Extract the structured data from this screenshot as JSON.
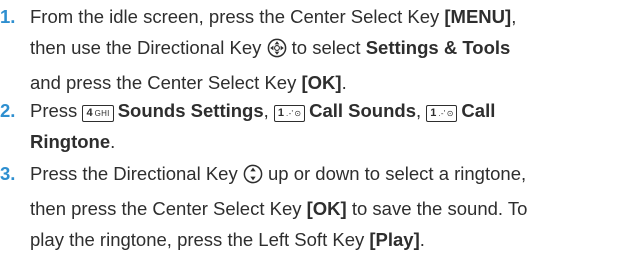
{
  "steps": [
    {
      "number": "1.",
      "line1": {
        "t1": "From the idle screen, press the Center Select Key ",
        "menu_key": "[MENU]",
        "t2": ","
      },
      "line2": {
        "t1": "then use the Directional Key ",
        "t2": " to select ",
        "settings_tools": "Settings & Tools"
      },
      "line3": {
        "t1": "and press the Center Select Key ",
        "ok_key": "[OK]",
        "t2": "."
      }
    },
    {
      "number": "2.",
      "line1": {
        "t1": "Press ",
        "key1_digit": "4",
        "key1_letters": "GHI",
        "sounds_settings": "Sounds Settings",
        "sep1": ", ",
        "key2_digit": "1",
        "key2_letters": ".-'",
        "call_sounds": "Call Sounds",
        "sep2": ", ",
        "key3_digit": "1",
        "key3_letters": ".-'",
        "call": "Call"
      },
      "line2": {
        "ringtone": "Ringtone",
        "t2": "."
      }
    },
    {
      "number": "3.",
      "line1": {
        "t1": "Press the Directional Key ",
        "t2": " up or down to select a ringtone,"
      },
      "line2": {
        "t1": "then press the Center Select Key ",
        "ok_key": "[OK]",
        "t2": " to save the sound. To"
      },
      "line3": {
        "t1": "play the ringtone, press the Left Soft Key ",
        "play_key": "[Play]",
        "t2": "."
      }
    }
  ],
  "icons": {
    "directional_four_way": "directional-key-four-way-icon",
    "directional_up_down": "directional-key-up-down-icon",
    "key_4": "key-4-ghi-icon",
    "key_1": "key-1-voicemail-icon"
  },
  "colors": {
    "step_number": "#2e8fd0",
    "text": "#2e2e2e"
  }
}
